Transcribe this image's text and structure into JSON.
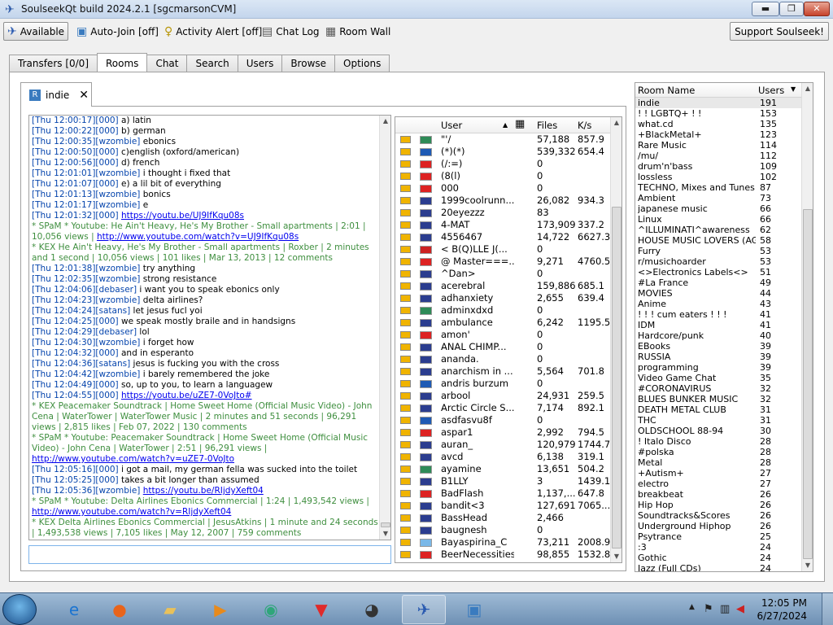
{
  "window": {
    "title": "SoulseekQt build 2024.2.1 [sgcmarsonCVM]",
    "min": "▬",
    "max": "❐",
    "close": "✕"
  },
  "toolbar": {
    "available": "Available",
    "autojoin": "Auto-Join [off]",
    "activity": "Activity Alert [off]",
    "chatlog": "Chat Log",
    "roomwall": "Room Wall",
    "support": "Support Soulseek!"
  },
  "tabs": [
    "Transfers [0/0]",
    "Rooms",
    "Chat",
    "Search",
    "Users",
    "Browse",
    "Options"
  ],
  "room_tab": {
    "label": "indie"
  },
  "chat": [
    {
      "ts": "[Thu 12:00:17]",
      "u": "[000]",
      "t": " a) latin"
    },
    {
      "ts": "[Thu 12:00:22]",
      "u": "[000]",
      "t": " b) german"
    },
    {
      "ts": "[Thu 12:00:35]",
      "u": "[wzombie]",
      "t": " ebonics"
    },
    {
      "ts": "[Thu 12:00:50]",
      "u": "[000]",
      "t": " c)english (oxford/american)"
    },
    {
      "ts": "[Thu 12:00:56]",
      "u": "[000]",
      "t": " d) french"
    },
    {
      "ts": "[Thu 12:01:01]",
      "u": "[wzombie]",
      "t": " i thought i fixed that"
    },
    {
      "ts": "[Thu 12:01:07]",
      "u": "[000]",
      "t": " e) a lil bit of everything"
    },
    {
      "ts": "[Thu 12:01:13]",
      "u": "[wzombie]",
      "t": " bonics"
    },
    {
      "ts": "[Thu 12:01:17]",
      "u": "[wzombie]",
      "t": " e"
    },
    {
      "ts": "[Thu 12:01:32]",
      "u": "[000]",
      "t": " ",
      "l": "https://youtu.be/UJ9IfKqu08s"
    },
    {
      "a": "* SPaM * Youtube: He Ain't Heavy, He's My Brother - Small apartments | 2:01 | 10,056 views | ",
      "l": "http://www.youtube.com/watch?v=UJ9IfKqu08s"
    },
    {
      "a": "* KEX He Ain't Heavy, He's My Brother - Small apartments | Roxber | 2 minutes and 1 second | 10,056 views | 101 likes | Mar 13, 2013 | 12 comments"
    },
    {
      "ts": "[Thu 12:01:38]",
      "u": "[wzombie]",
      "t": " try anything"
    },
    {
      "ts": "[Thu 12:02:35]",
      "u": "[wzombie]",
      "t": " strong resistance"
    },
    {
      "ts": "[Thu 12:04:06]",
      "u": "[debaser]",
      "t": " i want you to speak ebonics only"
    },
    {
      "ts": "[Thu 12:04:23]",
      "u": "[wzombie]",
      "t": " delta airlines?"
    },
    {
      "ts": "[Thu 12:04:24]",
      "u": "[satans]",
      "t": " let jesus fucl yoi"
    },
    {
      "ts": "[Thu 12:04:25]",
      "u": "[000]",
      "t": " we speak mostly braile and in handsigns"
    },
    {
      "ts": "[Thu 12:04:29]",
      "u": "[debaser]",
      "t": " lol"
    },
    {
      "ts": "[Thu 12:04:30]",
      "u": "[wzombie]",
      "t": " i forget how"
    },
    {
      "ts": "[Thu 12:04:32]",
      "u": "[000]",
      "t": " and in esperanto"
    },
    {
      "ts": "[Thu 12:04:36]",
      "u": "[satans]",
      "t": " jesus is fucking you with the cross"
    },
    {
      "ts": "[Thu 12:04:42]",
      "u": "[wzombie]",
      "t": " i barely remembered the joke"
    },
    {
      "ts": "[Thu 12:04:49]",
      "u": "[000]",
      "t": " so, up to you, to learn a languagew"
    },
    {
      "ts": "[Thu 12:04:55]",
      "u": "[000]",
      "t": " ",
      "l": "https://youtu.be/uZE7-0VoJto#"
    },
    {
      "a": "* KEX Peacemaker Soundtrack | Home Sweet Home (Official Music Video) - John Cena | WaterTower | WaterTower Music | 2 minutes and 51 seconds | 96,291 views | 2,815 likes | Feb 07, 2022 | 130 comments"
    },
    {
      "a": "* SPaM * Youtube: Peacemaker Soundtrack | Home Sweet Home (Official Music Video) - John Cena | WaterTower | 2:51 | 96,291 views | ",
      "l": "http://www.youtube.com/watch?v=uZE7-0VoJto"
    },
    {
      "ts": "[Thu 12:05:16]",
      "u": "[000]",
      "t": " i got a mail, my german fella was sucked into the toilet"
    },
    {
      "ts": "[Thu 12:05:25]",
      "u": "[000]",
      "t": " takes a bit longer than assumed"
    },
    {
      "ts": "[Thu 12:05:36]",
      "u": "[wzombie]",
      "t": " ",
      "l": "https://youtu.be/RIjdyXeft04"
    },
    {
      "a": "* SPaM * Youtube: Delta Airlines Ebonics Commercial | 1:24 | 1,493,542 views | ",
      "l": "http://www.youtube.com/watch?v=RIjdyXeft04"
    },
    {
      "a": "* KEX Delta Airlines Ebonics Commercial | JesusAtkins | 1 minute and 24 seconds | 1,493,538 views | 7,105 likes | May 12, 2007 | 759 comments"
    }
  ],
  "users_head": {
    "user": "User",
    "files": "Files",
    "speed": "K/s"
  },
  "users": [
    {
      "n": "\"'/",
      "f": "57,188",
      "s": "857.9",
      "c": "#2e8b57"
    },
    {
      "n": "(*)(*)",
      "f": "539,332",
      "s": "654.4",
      "c": "#1e5ab4"
    },
    {
      "n": "(/:=)",
      "f": "0",
      "s": "",
      "c": "#d22"
    },
    {
      "n": "(8(l)",
      "f": "0",
      "s": "",
      "c": "#d22"
    },
    {
      "n": "000",
      "f": "0",
      "s": "",
      "c": "#d22"
    },
    {
      "n": "1999coolrunn...",
      "f": "26,082",
      "s": "934.3",
      "c": "#2b3d8f"
    },
    {
      "n": "20eyezzz",
      "f": "83",
      "s": "",
      "c": "#2b3d8f"
    },
    {
      "n": "4-MAT",
      "f": "173,909",
      "s": "337.2",
      "c": "#2b3d8f"
    },
    {
      "n": "4556467",
      "f": "14,722",
      "s": "6627.3",
      "c": "#2b3d8f"
    },
    {
      "n": "< B(Q)LLE J(...",
      "f": "0",
      "s": "",
      "c": "#c22"
    },
    {
      "n": "@ Master===...",
      "f": "9,271",
      "s": "4760.5",
      "c": "#d22"
    },
    {
      "n": "^Dan>",
      "f": "0",
      "s": "",
      "c": "#2b3d8f"
    },
    {
      "n": "acerebral",
      "f": "159,886",
      "s": "685.1",
      "c": "#2b3d8f"
    },
    {
      "n": "adhanxiety",
      "f": "2,655",
      "s": "639.4",
      "c": "#2b3d8f"
    },
    {
      "n": "adminxdxd",
      "f": "0",
      "s": "",
      "c": "#2e8b57"
    },
    {
      "n": "ambulance",
      "f": "6,242",
      "s": "1195.5",
      "c": "#2b3d8f"
    },
    {
      "n": "amon'",
      "f": "0",
      "s": "",
      "c": "#d22"
    },
    {
      "n": "ANAL CHIMP...",
      "f": "0",
      "s": "",
      "c": "#2b3d8f"
    },
    {
      "n": "ananda.",
      "f": "0",
      "s": "",
      "c": "#2b3d8f"
    },
    {
      "n": "anarchism in ...",
      "f": "5,564",
      "s": "701.8",
      "c": "#2b3d8f"
    },
    {
      "n": "andris burzum",
      "f": "0",
      "s": "",
      "c": "#1e5ab4"
    },
    {
      "n": "arbool",
      "f": "24,931",
      "s": "259.5",
      "c": "#2b3d8f"
    },
    {
      "n": "Arctic Circle S...",
      "f": "7,174",
      "s": "892.1",
      "c": "#2b3d8f"
    },
    {
      "n": "asdfasvu8f",
      "f": "0",
      "s": "",
      "c": "#1e5ab4"
    },
    {
      "n": "aspar1",
      "f": "2,992",
      "s": "794.5",
      "c": "#d22"
    },
    {
      "n": "auran_",
      "f": "120,979",
      "s": "1744.7",
      "c": "#2b3d8f"
    },
    {
      "n": "avcd",
      "f": "6,138",
      "s": "319.1",
      "c": "#2b3d8f"
    },
    {
      "n": "ayamine",
      "f": "13,651",
      "s": "504.2",
      "c": "#2e8b57"
    },
    {
      "n": "B1LLY",
      "f": "3",
      "s": "1439.1",
      "c": "#2b3d8f"
    },
    {
      "n": "BadFlash",
      "f": "1,137,...",
      "s": "647.8",
      "c": "#d22"
    },
    {
      "n": "bandit<3",
      "f": "127,691",
      "s": "7065....",
      "c": "#2b3d8f"
    },
    {
      "n": "BassHead",
      "f": "2,466",
      "s": "",
      "c": "#2b3d8f"
    },
    {
      "n": "baugnesh",
      "f": "0",
      "s": "",
      "c": "#2b3d8f"
    },
    {
      "n": "Bayaspirina_C",
      "f": "73,211",
      "s": "2008.9",
      "c": "#7ab8e8"
    },
    {
      "n": "BeerNecessities",
      "f": "98,855",
      "s": "1532.8",
      "c": "#d22"
    }
  ],
  "rooms_head": {
    "name": "Room Name",
    "users": "Users"
  },
  "rooms": [
    {
      "n": "indie",
      "u": "191"
    },
    {
      "n": "! ! LGBTQ+ ! !",
      "u": "153"
    },
    {
      "n": "what.cd",
      "u": "135"
    },
    {
      "n": "+BlackMetal+",
      "u": "123"
    },
    {
      "n": "Rare Music",
      "u": "114"
    },
    {
      "n": "/mu/",
      "u": "112"
    },
    {
      "n": "drum'n'bass",
      "u": "109"
    },
    {
      "n": "lossless",
      "u": "102"
    },
    {
      "n": "TECHNO, Mixes and Tunes",
      "u": "87"
    },
    {
      "n": "Ambient",
      "u": "73"
    },
    {
      "n": "japanese music",
      "u": "66"
    },
    {
      "n": "Linux",
      "u": "66"
    },
    {
      "n": "^ILLUMINATI^awareness",
      "u": "62"
    },
    {
      "n": "HOUSE MUSIC LOVERS (AG)",
      "u": "58"
    },
    {
      "n": "Furry",
      "u": "53"
    },
    {
      "n": "r/musichoarder",
      "u": "53"
    },
    {
      "n": "<>Electronics Labels<>",
      "u": "51"
    },
    {
      "n": "#La France",
      "u": "49"
    },
    {
      "n": "MOVIES",
      "u": "44"
    },
    {
      "n": "Anime",
      "u": "43"
    },
    {
      "n": "! ! ! cum eaters ! ! !",
      "u": "41"
    },
    {
      "n": "IDM",
      "u": "41"
    },
    {
      "n": "Hardcore/punk",
      "u": "40"
    },
    {
      "n": "EBooks",
      "u": "39"
    },
    {
      "n": "RUSSIA",
      "u": "39"
    },
    {
      "n": "programming",
      "u": "39"
    },
    {
      "n": "Video Game Chat",
      "u": "35"
    },
    {
      "n": "#CORONAVIRUS",
      "u": "32"
    },
    {
      "n": "BLUES BUNKER MUSIC",
      "u": "32"
    },
    {
      "n": "DEATH METAL CLUB",
      "u": "31"
    },
    {
      "n": "THC",
      "u": "31"
    },
    {
      "n": "OLDSCHOOL 88-94",
      "u": "30"
    },
    {
      "n": "! Italo Disco",
      "u": "28"
    },
    {
      "n": "#polska",
      "u": "28"
    },
    {
      "n": "Metal",
      "u": "28"
    },
    {
      "n": "+Autism+",
      "u": "27"
    },
    {
      "n": "electro",
      "u": "27"
    },
    {
      "n": "breakbeat",
      "u": "26"
    },
    {
      "n": "Hip Hop",
      "u": "26"
    },
    {
      "n": "Soundtracks&Scores",
      "u": "26"
    },
    {
      "n": "Underground Hiphop",
      "u": "26"
    },
    {
      "n": "Psytrance",
      "u": "25"
    },
    {
      "n": ":3",
      "u": "24"
    },
    {
      "n": "Gothic",
      "u": "24"
    },
    {
      "n": "Jazz (Full CDs)",
      "u": "24"
    }
  ],
  "taskbar": {
    "time": "12:05 PM",
    "date": "6/27/2024"
  }
}
